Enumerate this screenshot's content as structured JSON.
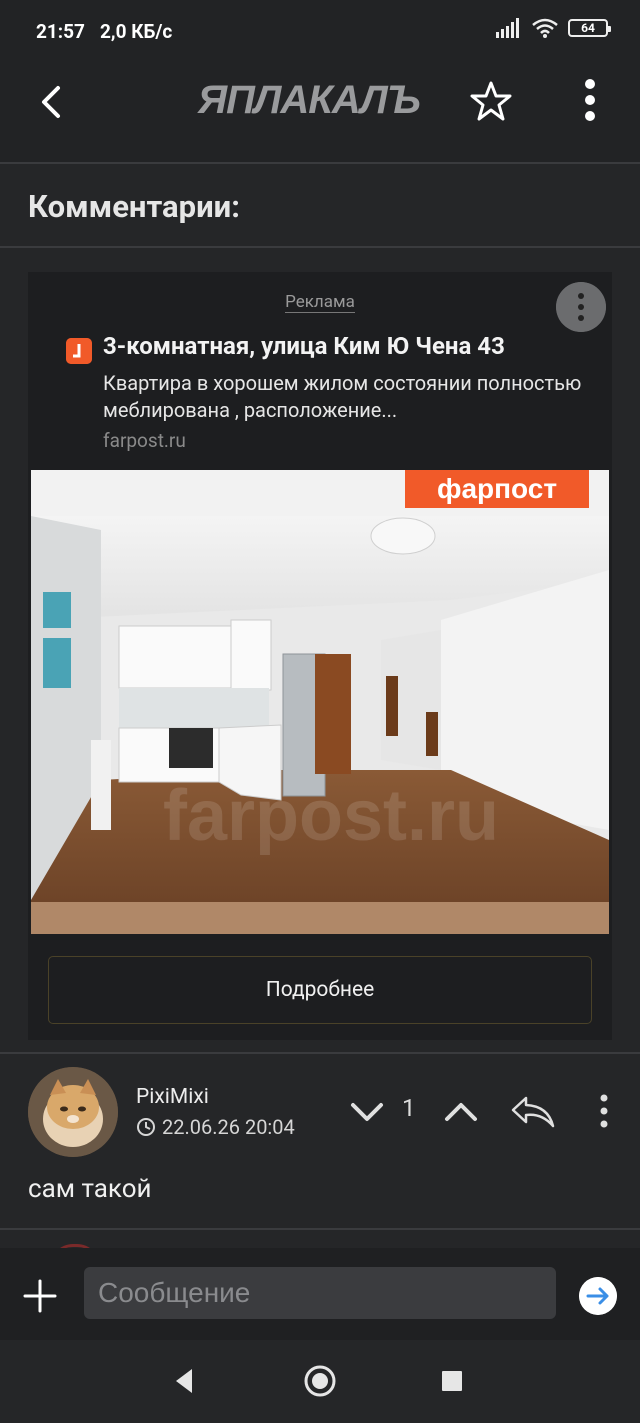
{
  "status_bar": {
    "time": "21:57",
    "speed": "2,0 КБ/с",
    "battery": "64"
  },
  "header": {
    "logo": "ЯПЛАКАЛЪ"
  },
  "comments_title": "Комментарии:",
  "ad": {
    "label": "Реклама",
    "title": "3-комнатная, улица Ким Ю Чена 43",
    "description": "Квартира в хорошем жилом состоянии полностью меблирована , расположение...",
    "domain": "farpost.ru",
    "brand_badge": "фарпост",
    "watermark": "farpost.ru",
    "button_label": "Подробнее"
  },
  "comment": {
    "username": "PixiMixi",
    "date": "22.06.26 20:04",
    "votes": "1",
    "text": "сам такой"
  },
  "composer": {
    "placeholder": "Сообщение"
  },
  "colors": {
    "accent": "#f15a29",
    "send": "#3a8ee6"
  }
}
